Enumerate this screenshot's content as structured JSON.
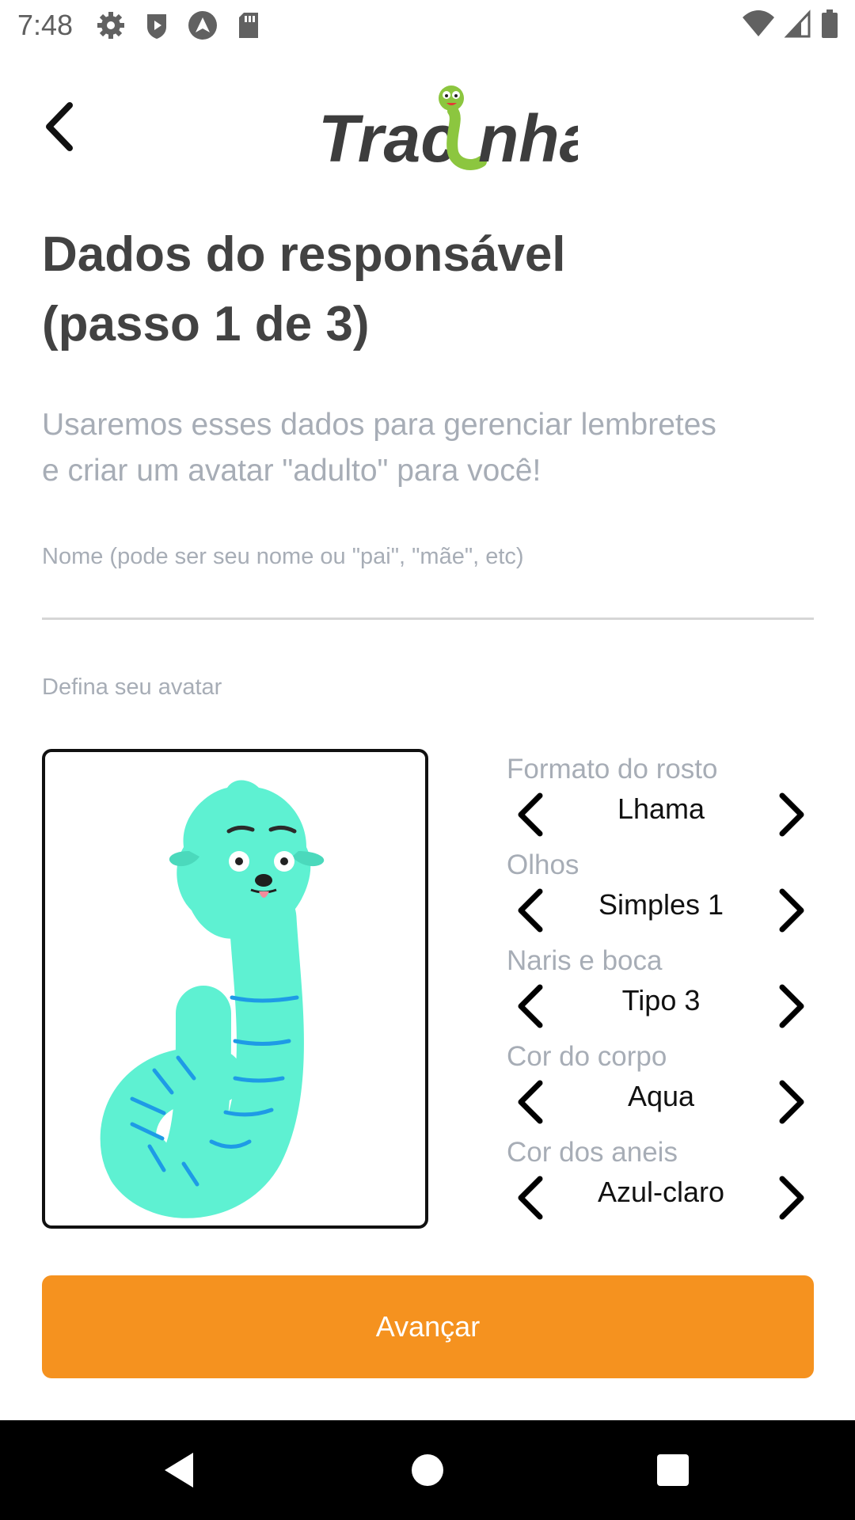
{
  "status_bar": {
    "time": "7:48",
    "left_icons": [
      "settings-icon",
      "shield-play-icon",
      "android-auto-icon",
      "sd-card-icon"
    ],
    "right_icons": [
      "wifi-icon",
      "cell-signal-icon",
      "battery-icon"
    ]
  },
  "header": {
    "back_icon": "chevron-left-icon",
    "logo_text": "TracInha"
  },
  "page": {
    "title_line1": "Dados do responsável",
    "title_line2": "(passo 1 de 3)",
    "subtitle_line1": "Usaremos esses dados para gerenciar lembretes",
    "subtitle_line2": "e criar um avatar \"adulto\" para você!"
  },
  "form": {
    "name_label": "Nome (pode ser seu nome ou \"pai\", \"mãe\", etc)",
    "name_value": "",
    "avatar_label": "Defina seu avatar"
  },
  "avatar_options": [
    {
      "label": "Formato do rosto",
      "value": "Lhama"
    },
    {
      "label": "Olhos",
      "value": "Simples 1"
    },
    {
      "label": "Naris e boca",
      "value": "Tipo 3"
    },
    {
      "label": "Cor do corpo",
      "value": "Aqua"
    },
    {
      "label": "Cor dos aneis",
      "value": "Azul-claro"
    }
  ],
  "actions": {
    "advance_label": "Avançar"
  },
  "colors": {
    "accent": "#f5921f",
    "avatar_body": "#5ef1d2",
    "avatar_rings": "#1e9be6",
    "title_text": "#424242",
    "muted_text": "#a7adb6"
  },
  "nav_bar": {
    "icons": [
      "nav-back-icon",
      "nav-home-icon",
      "nav-recents-icon"
    ]
  }
}
